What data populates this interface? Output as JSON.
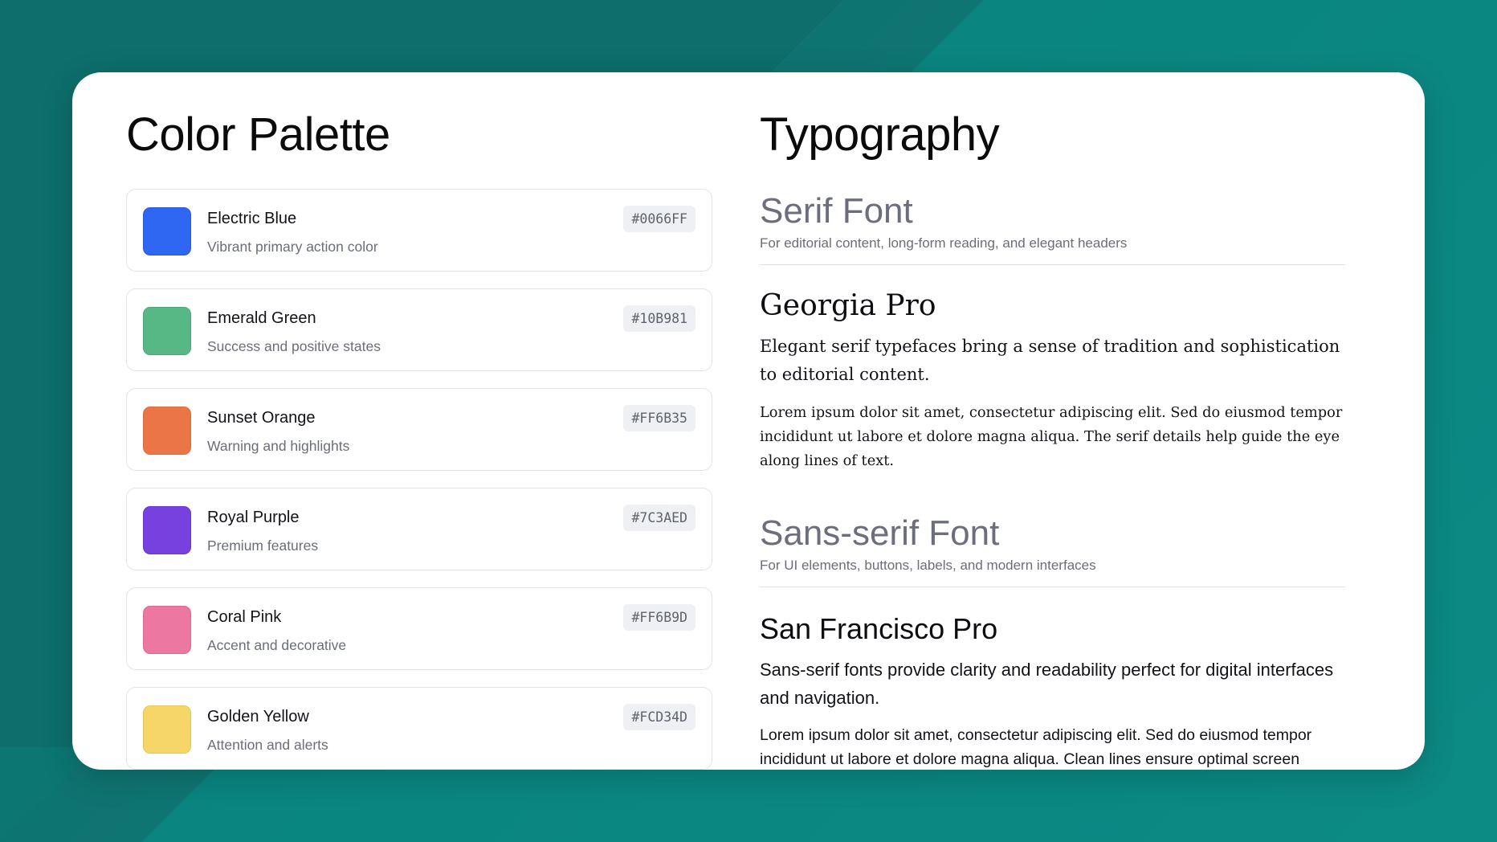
{
  "colors": {
    "background": "#0c8a84",
    "card": "#ffffff"
  },
  "palette": {
    "title": "Color Palette",
    "items": [
      {
        "name": "Electric Blue",
        "description": "Vibrant primary action color",
        "hex": "#0066FF",
        "swatch": "#2f66f2"
      },
      {
        "name": "Emerald Green",
        "description": "Success and positive states",
        "hex": "#10B981",
        "swatch": "#57b886"
      },
      {
        "name": "Sunset Orange",
        "description": "Warning and highlights",
        "hex": "#FF6B35",
        "swatch": "#ec7548"
      },
      {
        "name": "Royal Purple",
        "description": "Premium features",
        "hex": "#7C3AED",
        "swatch": "#7741e0"
      },
      {
        "name": "Coral Pink",
        "description": "Accent and decorative",
        "hex": "#FF6B9D",
        "swatch": "#ec77a0"
      },
      {
        "name": "Golden Yellow",
        "description": "Attention and alerts",
        "hex": "#FCD34D",
        "swatch": "#f7d669"
      }
    ]
  },
  "typography": {
    "title": "Typography",
    "serif": {
      "heading": "Serif Font",
      "subtitle": "For editorial content, long-form reading, and elegant headers",
      "font_name": "Georgia Pro",
      "lead": "Elegant serif typefaces bring a sense of tradition and sophistication to editorial content.",
      "body": "Lorem ipsum dolor sit amet, consectetur adipiscing elit. Sed do eiusmod tempor incididunt ut labore et dolore magna aliqua. The serif details help guide the eye along lines of text."
    },
    "sans": {
      "heading": "Sans-serif Font",
      "subtitle": "For UI elements, buttons, labels, and modern interfaces",
      "font_name": "San Francisco Pro",
      "lead": "Sans-serif fonts provide clarity and readability perfect for digital interfaces and navigation.",
      "body": "Lorem ipsum dolor sit amet, consectetur adipiscing elit. Sed do eiusmod tempor incididunt ut labore et dolore magna aliqua. Clean lines ensure optimal screen"
    }
  }
}
